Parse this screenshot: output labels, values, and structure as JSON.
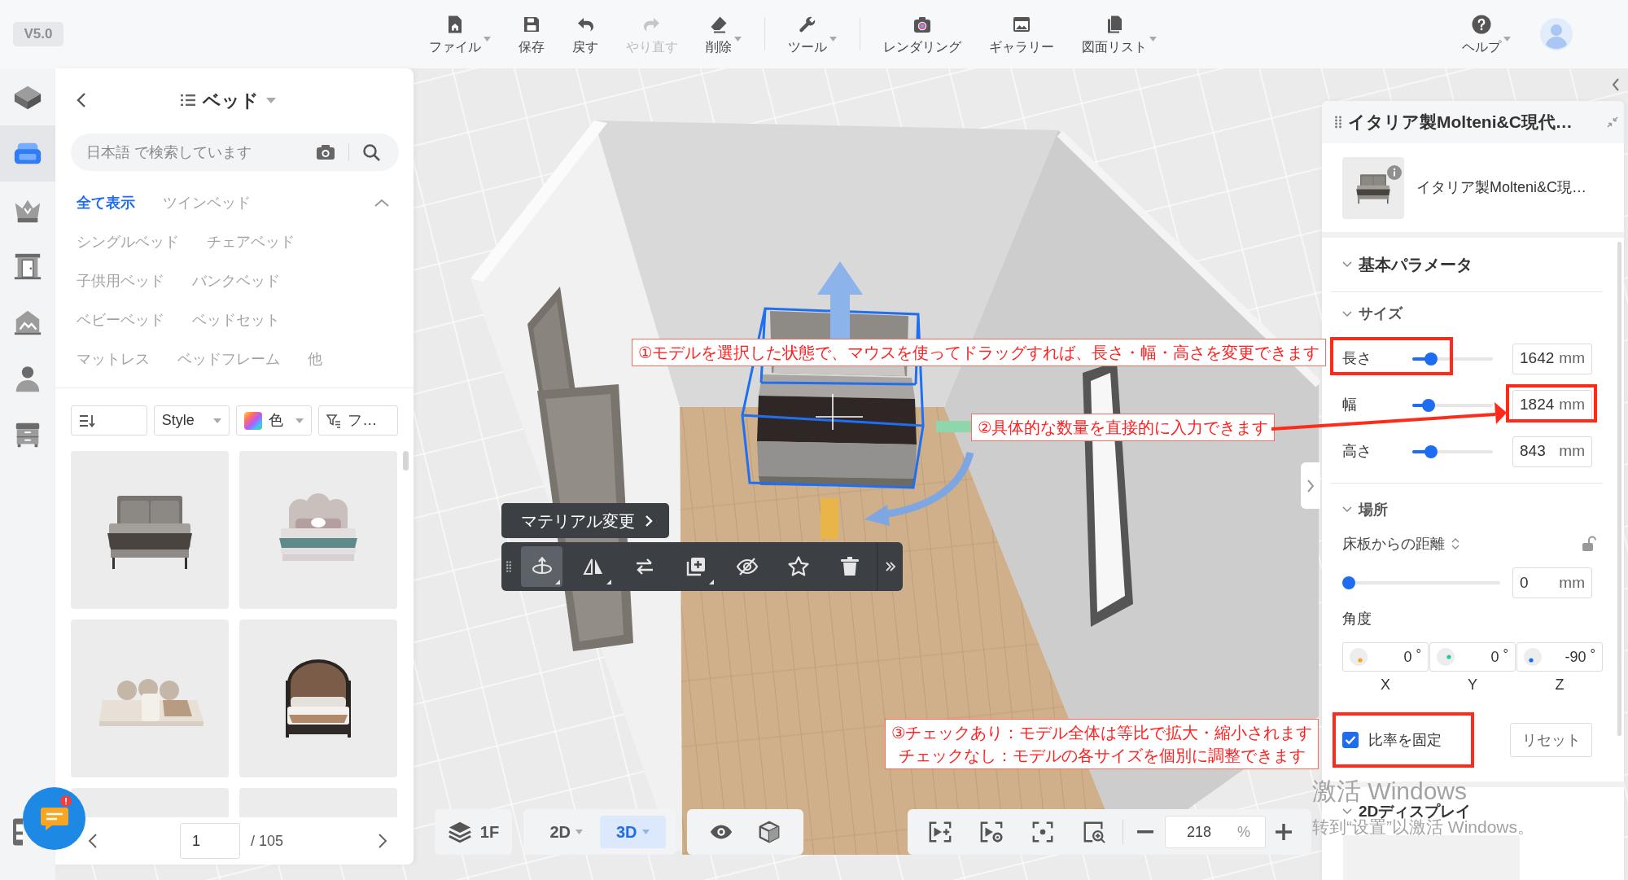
{
  "version": "V5.0",
  "toolbar_groups": [
    {
      "items": [
        {
          "label": "ファイル",
          "kind": "file",
          "dropdown": true,
          "disabled": false
        },
        {
          "label": "保存",
          "kind": "save",
          "dropdown": false,
          "disabled": false
        },
        {
          "label": "戻す",
          "kind": "undo",
          "dropdown": false,
          "disabled": false
        },
        {
          "label": "やり直す",
          "kind": "redo",
          "dropdown": false,
          "disabled": true
        },
        {
          "label": "削除",
          "kind": "erase",
          "dropdown": true,
          "disabled": false
        }
      ]
    },
    {
      "items": [
        {
          "label": "ツール",
          "kind": "tool",
          "dropdown": true,
          "disabled": false
        }
      ]
    },
    {
      "items": [
        {
          "label": "レンダリング",
          "kind": "render",
          "dropdown": false,
          "disabled": false
        },
        {
          "label": "ギャラリー",
          "kind": "gallery",
          "dropdown": false,
          "disabled": false
        },
        {
          "label": "図面リスト",
          "kind": "documents",
          "dropdown": true,
          "disabled": false
        }
      ]
    }
  ],
  "help": {
    "label": "ヘルプ",
    "dropdown": true
  },
  "sidebar": {
    "items": [
      {
        "kind": "structure",
        "selected": false
      },
      {
        "kind": "furniture",
        "selected": true
      },
      {
        "kind": "decor",
        "selected": false
      },
      {
        "kind": "door",
        "selected": false
      },
      {
        "kind": "terrain",
        "selected": false
      },
      {
        "kind": "person",
        "selected": false
      },
      {
        "kind": "cabinet",
        "selected": false
      }
    ],
    "bottom_items": [
      {
        "kind": "layout",
        "selected": false
      }
    ]
  },
  "catalog": {
    "title": "ベッド",
    "search": {
      "placeholder": "日本語 で検索しています"
    },
    "categories": [
      {
        "label": "全て表示",
        "selected": true
      },
      {
        "label": "ツインベッド",
        "selected": false
      },
      {
        "label": "シングルベッド",
        "selected": false
      },
      {
        "label": "チェアベッド",
        "selected": false
      },
      {
        "label": "子供用ベッド",
        "selected": false
      },
      {
        "label": "バンクベッド",
        "selected": false
      },
      {
        "label": "ベビーベッド",
        "selected": false
      },
      {
        "label": "ベッドセット",
        "selected": false
      },
      {
        "label": "マットレス",
        "selected": false
      },
      {
        "label": "ベッドフレーム",
        "selected": false
      },
      {
        "label": "他",
        "selected": false
      }
    ],
    "filters": [
      {
        "kind": "sort"
      },
      {
        "kind": "select",
        "label": "Style"
      },
      {
        "kind": "color",
        "label": "色"
      },
      {
        "kind": "filter",
        "label": "フ…"
      }
    ],
    "products": [
      {
        "kind": "upholstered"
      },
      {
        "kind": "scalloped"
      },
      {
        "kind": "floor"
      },
      {
        "kind": "arched"
      },
      {
        "kind": "blank"
      },
      {
        "kind": "blank"
      }
    ],
    "pagination": {
      "page": "1",
      "total": "/ 105"
    }
  },
  "chat": {
    "unread": true
  },
  "viewport": {
    "material_button": "マテリアル変更",
    "tools": [
      {
        "kind": "move",
        "selected": true,
        "submenu": true
      },
      {
        "kind": "mirror",
        "selected": false,
        "submenu": true
      },
      {
        "kind": "swap",
        "selected": false,
        "submenu": false
      },
      {
        "kind": "duplicate",
        "selected": false,
        "submenu": true
      },
      {
        "kind": "hide",
        "selected": false,
        "submenu": false
      },
      {
        "kind": "favorite",
        "selected": false,
        "submenu": false
      },
      {
        "kind": "delete",
        "selected": false,
        "submenu": false
      }
    ],
    "floor": "1F",
    "view_modes": [
      {
        "label": "2D",
        "selected": false
      },
      {
        "label": "3D",
        "selected": true
      }
    ],
    "zoom": {
      "value": "218",
      "unit": "%"
    }
  },
  "properties": {
    "title": "イタリア製Molteni&C現代…",
    "product_name": "イタリア製Molteni&C現…",
    "basic_heading": "基本パラメータ",
    "size": {
      "heading": "サイズ",
      "rows": [
        {
          "label": "長さ",
          "level": 0.18,
          "value": "1642",
          "unit": "mm"
        },
        {
          "label": "幅",
          "level": 0.14,
          "value": "1824",
          "unit": "mm"
        },
        {
          "label": "高さ",
          "level": 0.18,
          "value": "843",
          "unit": "mm"
        }
      ]
    },
    "position": {
      "heading": "場所",
      "distance_label": "床板からの距離",
      "locked": false,
      "distance": {
        "level": 0,
        "value": "0",
        "unit": "mm"
      },
      "angle_label": "角度",
      "angles": [
        {
          "axis": "X",
          "value": "0",
          "unit": "°",
          "color": "#f5a623"
        },
        {
          "axis": "Y",
          "value": "0",
          "unit": "°",
          "color": "#26c9a0"
        },
        {
          "axis": "Z",
          "value": "-90",
          "unit": "°",
          "color": "#1e6cf0"
        }
      ]
    },
    "ratio_lock": {
      "label": "比率を固定",
      "checked": true
    },
    "reset_button": "リセット",
    "display_heading": "2Dディスプレイ"
  },
  "annotations": [
    {
      "lines": [
        "①モデルを選択した状態で、マウスを使ってドラッグすれば、長さ・幅・高さを変更できます"
      ]
    },
    {
      "lines": [
        "②具体的な数量を直接的に入力できます"
      ]
    },
    {
      "lines": [
        "③チェックあり：モデル全体は等比で拡大・縮小されます",
        "チェックなし：モデルの各サイズを個別に調整できます"
      ]
    }
  ],
  "os_notice": {
    "title": "激活 Windows",
    "text": "转到“设置”以激活 Windows。"
  }
}
